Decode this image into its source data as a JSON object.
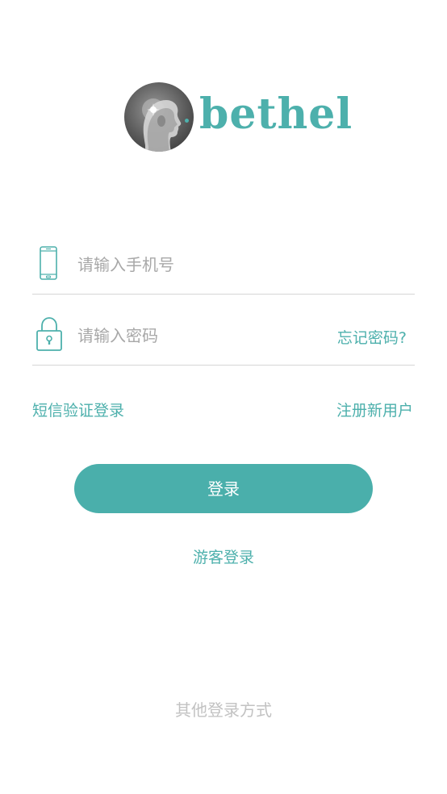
{
  "logo": {
    "brand_text": "bethel"
  },
  "form": {
    "phone": {
      "placeholder": "请输入手机号",
      "value": "",
      "icon": "phone-icon"
    },
    "password": {
      "placeholder": "请输入密码",
      "value": "",
      "icon": "lock-icon",
      "forgot_label": "忘记密码?"
    }
  },
  "links": {
    "sms_login": "短信验证登录",
    "register": "注册新用户",
    "guest_login": "游客登录"
  },
  "login_button": {
    "label": "登录"
  },
  "footer": {
    "other_login_label": "其他登录方式"
  },
  "colors": {
    "accent": "#4aafab",
    "placeholder": "#a8a8a8",
    "divider": "#d6d6d6",
    "muted": "#c2c2c2"
  }
}
